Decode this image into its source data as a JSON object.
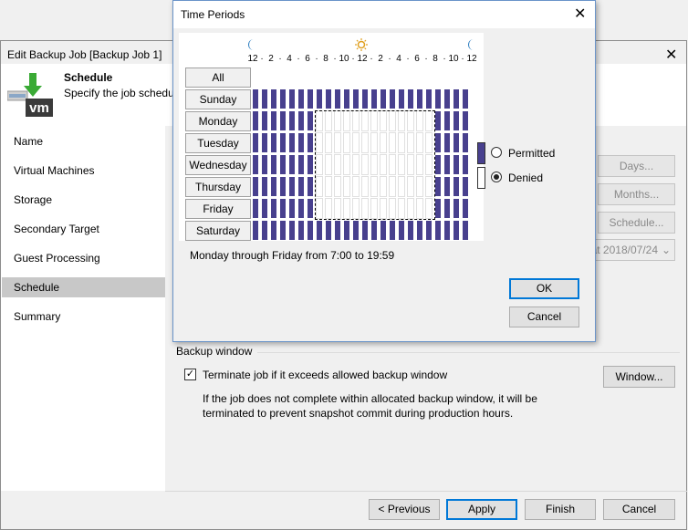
{
  "window": {
    "title": "Edit Backup Job [Backup Job 1]",
    "close": "✕"
  },
  "header": {
    "title": "Schedule",
    "subtitle": "Specify the job schedu",
    "logo_text": "vm"
  },
  "sidebar": {
    "items": [
      "Name",
      "Virtual Machines",
      "Storage",
      "Secondary Target",
      "Guest Processing",
      "Schedule",
      "Summary"
    ],
    "selected": "Schedule"
  },
  "right_buttons": {
    "days": "Days...",
    "months": "Months...",
    "schedule": "Schedule...",
    "date_value": "at 2018/07/24"
  },
  "backup_window": {
    "group_label": "Backup window",
    "checkbox_label": "Terminate job if it exceeds allowed backup window",
    "checked": true,
    "window_button": "Window...",
    "description": "If the job does not complete within allocated backup window, it will be terminated to prevent snapshot commit during production hours."
  },
  "footer": {
    "previous": "< Previous",
    "apply": "Apply",
    "finish": "Finish",
    "cancel": "Cancel"
  },
  "dialog": {
    "title": "Time Periods",
    "close": "✕",
    "hour_labels": [
      "12",
      "2",
      "4",
      "6",
      "8",
      "10",
      "12",
      "2",
      "4",
      "6",
      "8",
      "10",
      "12"
    ],
    "all_label": "All",
    "days": [
      "Sunday",
      "Monday",
      "Tuesday",
      "Wednesday",
      "Thursday",
      "Friday",
      "Saturday"
    ],
    "permitted_label": "Permitted",
    "denied_label": "Denied",
    "selected_option": "Denied",
    "summary": "Monday through Friday from 7:00 to 19:59",
    "ok": "OK",
    "cancel": "Cancel",
    "permitted_days": [
      1,
      2,
      3,
      4,
      5
    ],
    "permitted_hours_start": 7,
    "permitted_hours_end": 19,
    "colors": {
      "denied": "#48408e",
      "permitted": "#ffffff",
      "moon": "#2f7fc1",
      "sun": "#e0a020"
    }
  }
}
